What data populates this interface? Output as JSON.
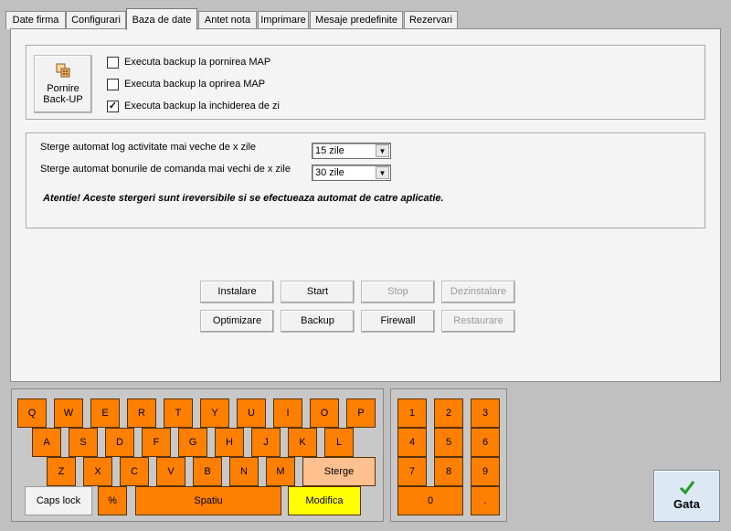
{
  "tabs": [
    "Date firma",
    "Configurari",
    "Baza de date",
    "Antet nota",
    "Imprimare",
    "Mesaje predefinite",
    "Rezervari"
  ],
  "backup": {
    "button_label_line1": "Pornire",
    "button_label_line2": "Back-UP",
    "checks": [
      {
        "label": "Executa backup la pornirea MAP",
        "checked": false
      },
      {
        "label": "Executa backup la oprirea MAP",
        "checked": false
      },
      {
        "label": "Executa backup la inchiderea de zi",
        "checked": true
      }
    ]
  },
  "cleanup": {
    "log_label": "Sterge automat log activitate mai veche de x zile",
    "log_value": "15 zile",
    "orders_label": "Sterge automat bonurile de comanda mai vechi de x zile",
    "orders_value": "30 zile",
    "warning": "Atentie! Aceste stergeri sunt ireversibile si se efectueaza automat de catre aplicatie."
  },
  "service_buttons": {
    "install": "Instalare",
    "start": "Start",
    "stop": "Stop",
    "uninstall": "Dezinstalare",
    "optimize": "Optimizare",
    "backup": "Backup",
    "firewall": "Firewall",
    "restore": "Restaurare"
  },
  "keyboard": {
    "row1": [
      "Q",
      "W",
      "E",
      "R",
      "T",
      "Y",
      "U",
      "I",
      "O",
      "P"
    ],
    "row2": [
      "A",
      "S",
      "D",
      "F",
      "G",
      "H",
      "J",
      "K",
      "L"
    ],
    "row3": [
      "Z",
      "X",
      "C",
      "V",
      "B",
      "N",
      "M"
    ],
    "erase": "Sterge",
    "caps": "Caps lock",
    "percent": "%",
    "space": "Spatiu",
    "modify": "Modifica"
  },
  "numpad": {
    "keys": [
      "1",
      "2",
      "3",
      "4",
      "5",
      "6",
      "7",
      "8",
      "9"
    ],
    "zero": "0",
    "dot": "."
  },
  "done": "Gata",
  "colors": {
    "key": "#ff8000",
    "key_light": "#ffc090",
    "key_yellow": "#ffff00",
    "done_check": "#1f9a1f"
  }
}
